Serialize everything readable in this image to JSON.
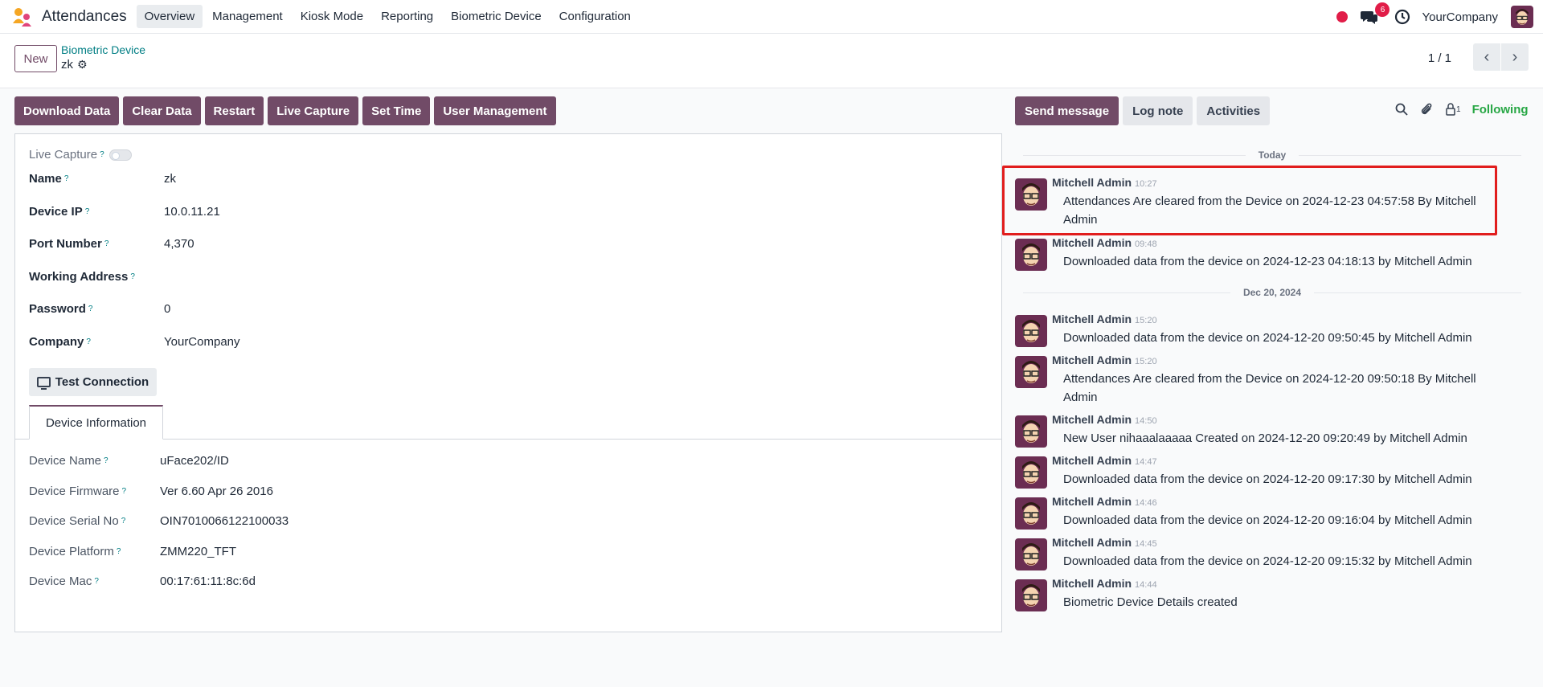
{
  "app": {
    "name": "Attendances"
  },
  "menu": [
    "Overview",
    "Management",
    "Kiosk Mode",
    "Reporting",
    "Biometric Device",
    "Configuration"
  ],
  "nav": {
    "chat_badge": "6",
    "company": "YourCompany"
  },
  "control": {
    "new_label": "New",
    "breadcrumb": "Biometric Device",
    "record": "zk",
    "pager": "1 / 1"
  },
  "actions": [
    "Download Data",
    "Clear Data",
    "Restart",
    "Live Capture",
    "Set Time",
    "User Management"
  ],
  "form": {
    "live_capture_label": "Live Capture",
    "qmark": "?",
    "fields": [
      {
        "label": "Name",
        "value": "zk"
      },
      {
        "label": "Device IP",
        "value": "10.0.11.21"
      },
      {
        "label": "Port Number",
        "value": "4,370"
      },
      {
        "label": "Working Address",
        "value": ""
      },
      {
        "label": "Password",
        "value": "0"
      },
      {
        "label": "Company",
        "value": "YourCompany"
      }
    ],
    "test_connection": "Test Connection",
    "tab": "Device Information",
    "info": [
      {
        "label": "Device Name",
        "value": "uFace202/ID"
      },
      {
        "label": "Device Firmware",
        "value": "Ver 6.60 Apr 26 2016"
      },
      {
        "label": "Device Serial No",
        "value": "OIN7010066122100033"
      },
      {
        "label": "Device Platform",
        "value": "ZMM220_TFT"
      },
      {
        "label": "Device Mac",
        "value": "00:17:61:11:8c:6d"
      }
    ]
  },
  "chatter": {
    "send_message": "Send message",
    "log_note": "Log note",
    "activities": "Activities",
    "follower_count": "1",
    "following": "Following",
    "sep_today": "Today",
    "sep_dec20": "Dec 20, 2024",
    "messages": [
      {
        "author": "Mitchell Admin",
        "time": "10:27",
        "body": "Attendances Are cleared from the Device on 2024-12-23 04:57:58 By Mitchell Admin"
      },
      {
        "author": "Mitchell Admin",
        "time": "09:48",
        "body": "Downloaded data from the device on 2024-12-23 04:18:13 by Mitchell Admin"
      },
      {
        "author": "Mitchell Admin",
        "time": "15:20",
        "body": "Downloaded data from the device on 2024-12-20 09:50:45 by Mitchell Admin"
      },
      {
        "author": "Mitchell Admin",
        "time": "15:20",
        "body": "Attendances Are cleared from the Device on 2024-12-20 09:50:18 By Mitchell Admin"
      },
      {
        "author": "Mitchell Admin",
        "time": "14:50",
        "body": "New User nihaaalaaaaa Created on 2024-12-20 09:20:49 by Mitchell Admin"
      },
      {
        "author": "Mitchell Admin",
        "time": "14:47",
        "body": "Downloaded data from the device on 2024-12-20 09:17:30 by Mitchell Admin"
      },
      {
        "author": "Mitchell Admin",
        "time": "14:46",
        "body": "Downloaded data from the device on 2024-12-20 09:16:04 by Mitchell Admin"
      },
      {
        "author": "Mitchell Admin",
        "time": "14:45",
        "body": "Downloaded data from the device on 2024-12-20 09:15:32 by Mitchell Admin"
      },
      {
        "author": "Mitchell Admin",
        "time": "14:44",
        "body": "Biometric Device Details created"
      }
    ]
  }
}
